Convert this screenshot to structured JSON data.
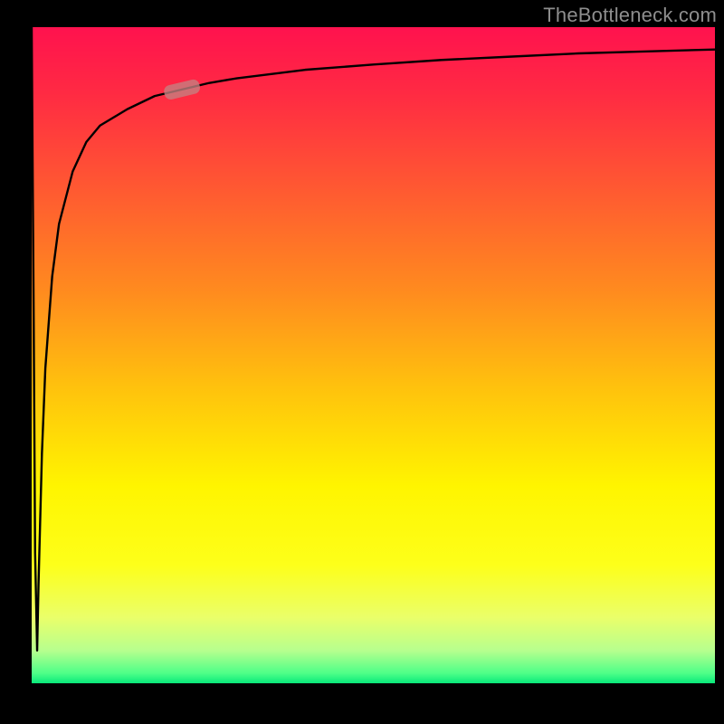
{
  "watermark": "TheBottleneck.com",
  "chart_data": {
    "type": "line",
    "title": "",
    "xlabel": "",
    "ylabel": "",
    "xlim": [
      0,
      100
    ],
    "ylim": [
      0,
      100
    ],
    "grid": false,
    "legend": false,
    "series": [
      {
        "name": "bottleneck-curve",
        "x": [
          0.0,
          0.3,
          0.5,
          0.8,
          1.0,
          1.5,
          2.0,
          3.0,
          4.0,
          6.0,
          8.0,
          10.0,
          14.0,
          18.0,
          22.0,
          26.0,
          30.0,
          40.0,
          50.0,
          60.0,
          70.0,
          80.0,
          90.0,
          100.0
        ],
        "y": [
          100.0,
          55.0,
          20.0,
          5.0,
          15.0,
          35.0,
          48.0,
          62.0,
          70.0,
          78.0,
          82.5,
          85.0,
          87.5,
          89.5,
          90.5,
          91.5,
          92.2,
          93.5,
          94.3,
          95.0,
          95.5,
          96.0,
          96.3,
          96.6
        ]
      }
    ],
    "annotations": [
      {
        "name": "operating-point-marker",
        "x": 22.0,
        "y": 90.5
      }
    ],
    "background_gradient_stops": [
      {
        "offset": 0.0,
        "color": "#ff124e"
      },
      {
        "offset": 0.1,
        "color": "#ff2a43"
      },
      {
        "offset": 0.25,
        "color": "#ff5a31"
      },
      {
        "offset": 0.4,
        "color": "#ff8a1f"
      },
      {
        "offset": 0.55,
        "color": "#ffc20d"
      },
      {
        "offset": 0.7,
        "color": "#fff500"
      },
      {
        "offset": 0.82,
        "color": "#fdff1a"
      },
      {
        "offset": 0.9,
        "color": "#eaff6a"
      },
      {
        "offset": 0.95,
        "color": "#b7ff8e"
      },
      {
        "offset": 0.985,
        "color": "#4dff88"
      },
      {
        "offset": 1.0,
        "color": "#08e87a"
      }
    ]
  }
}
